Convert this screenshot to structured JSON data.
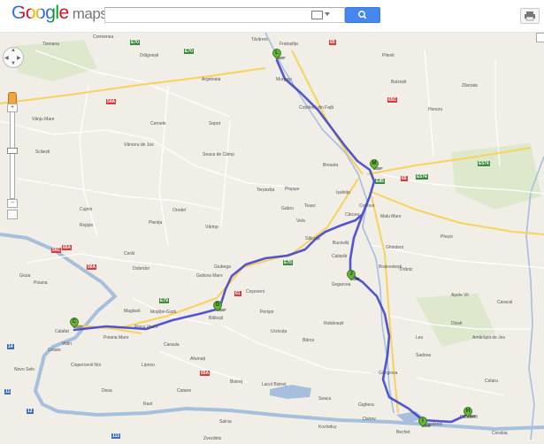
{
  "header": {
    "logo_google": "Google",
    "logo_maps": "maps",
    "search_value": "",
    "search_placeholder": ""
  },
  "colors": {
    "route": "#3b3fcc",
    "map_land": "#f1eee8",
    "water": "#a6bfdc",
    "marker": "#68b33a",
    "search_button": "#4787ed"
  },
  "icons": [
    "keyboard-icon",
    "search-icon",
    "print-icon",
    "pan-control-icon",
    "pegman-icon",
    "zoom-in-icon",
    "zoom-out-icon",
    "zoom-box-icon"
  ],
  "markers": [
    {
      "letter": "L"
    },
    {
      "letter": "M"
    },
    {
      "letter": "J"
    },
    {
      "letter": "D"
    },
    {
      "letter": "C"
    },
    {
      "letter": "I"
    },
    {
      "letter": "H"
    }
  ],
  "road_shields": [
    {
      "text": "E70",
      "kind": "green"
    },
    {
      "text": "E70",
      "kind": "green"
    },
    {
      "text": "E79",
      "kind": "green"
    },
    {
      "text": "E574",
      "kind": "green"
    },
    {
      "text": "E574",
      "kind": "green"
    },
    {
      "text": "E85",
      "kind": "green"
    },
    {
      "text": "E70",
      "kind": "green"
    },
    {
      "text": "65",
      "kind": "red"
    },
    {
      "text": "66A",
      "kind": "red"
    },
    {
      "text": "56C",
      "kind": "red"
    },
    {
      "text": "56A",
      "kind": "red"
    },
    {
      "text": "54A",
      "kind": "red"
    },
    {
      "text": "65C",
      "kind": "red"
    },
    {
      "text": "65",
      "kind": "red"
    },
    {
      "text": "65A",
      "kind": "red"
    },
    {
      "text": "61",
      "kind": "red"
    },
    {
      "text": "11",
      "kind": "blue"
    },
    {
      "text": "12",
      "kind": "blue"
    },
    {
      "text": "14",
      "kind": "blue"
    },
    {
      "text": "112",
      "kind": "blue"
    }
  ],
  "map_labels": [
    "Tismana",
    "Fratoștița",
    "Cremenea",
    "Pitesti",
    "Tărăreni",
    "Drăgoești",
    "Breasta",
    "Murgași",
    "Bulzești",
    "Zăvoaia",
    "Sopot",
    "Seaca de Câmp",
    "Vârvoru de Jos",
    "Scăești",
    "Argetoaia",
    "Coțofenii din Față",
    "Cernele",
    "Teasc",
    "Cârcea",
    "Calafat",
    "Ciupercenii Noi",
    "Poiana Mare",
    "Desa",
    "Băilești",
    "Cetate",
    "Moțăței-Gară",
    "Maglavit",
    "Galicea Mare",
    "Giubega",
    "Rast",
    "Afumați",
    "Bârca",
    "Urzicuța",
    "Gighera",
    "Sadova",
    "Celaru",
    "Caracal",
    "Corabia",
    "Dăbuleni",
    "Bechet",
    "Segarcea",
    "Leu",
    "Diosti",
    "Amărăștii de Jos",
    "Drănic",
    "Craiova",
    "Ișalnița",
    "Gângiova",
    "Horezu",
    "Apele Vii",
    "Bratovoiești",
    "Calopăr",
    "Vârtop",
    "Plenița",
    "Orodel",
    "Cerăt",
    "Bistreț",
    "Lacul Bistreț",
    "Vidin",
    "Novo Selo",
    "Poiana",
    "Rojiște",
    "Gruia",
    "Cujmir",
    "Vânju Mare",
    "Ghindeni",
    "Bucovăț",
    "Malu Mare",
    "Robănești",
    "Perișor",
    "Caraula",
    "Dobridor",
    "Lipovu",
    "Catane",
    "Salcia",
    "Kozloduy",
    "Zvezdets",
    "Ostrov",
    "Piscu Vechi",
    "Seaca",
    "Pleșoi",
    "Gabru",
    "Vela",
    "Sălcuța",
    "Terpezița",
    "Plopșor",
    "Coșoveni",
    "Dunăreni"
  ]
}
